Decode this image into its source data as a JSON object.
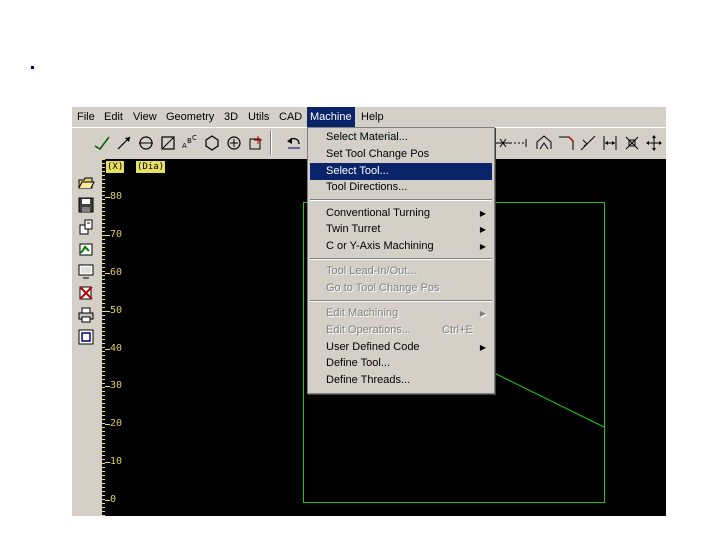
{
  "menubar": {
    "items": [
      {
        "label": "File"
      },
      {
        "label": "Edit"
      },
      {
        "label": "View"
      },
      {
        "label": "Geometry"
      },
      {
        "label": "3D"
      },
      {
        "label": "Utils"
      },
      {
        "label": "CAD"
      },
      {
        "label": "Machine"
      },
      {
        "label": "Help"
      }
    ]
  },
  "machine_menu": {
    "items": [
      {
        "label": "Select Material..."
      },
      {
        "label": "Set Tool Change Pos"
      },
      {
        "label": "Select Tool..."
      },
      {
        "label": "Tool Directions..."
      },
      {
        "label": "Conventional Turning"
      },
      {
        "label": "Twin Turret"
      },
      {
        "label": "C or Y-Axis Machining"
      },
      {
        "label": "Tool Lead-In/Out..."
      },
      {
        "label": "Go to Tool Change Pos"
      },
      {
        "label": "Edit Machining"
      },
      {
        "label": "Edit Operations...",
        "shortcut": "Ctrl+E"
      },
      {
        "label": "User Defined Code"
      },
      {
        "label": "Define Tool..."
      },
      {
        "label": "Define Threads..."
      }
    ]
  },
  "canvas": {
    "coord_x_label": "(X)",
    "coord_dia_label": "(Dia)",
    "y_ticks": [
      "80",
      "70",
      "60",
      "50",
      "40",
      "30",
      "20",
      "10",
      "0"
    ],
    "background": "#000000",
    "geometry_color": "#22c422",
    "ruler_color": "#e8e060"
  },
  "colors": {
    "menu_highlight": "#0a246a",
    "chrome": "#d4d0c8"
  }
}
